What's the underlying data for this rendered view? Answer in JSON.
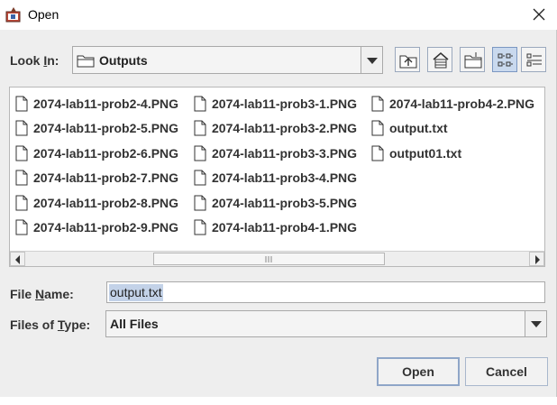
{
  "window": {
    "title": "Open"
  },
  "look_in": {
    "label_pre": "Look ",
    "label_mnemonic": "I",
    "label_post": "n:",
    "value": "Outputs"
  },
  "toolbar": {
    "up_icon": "up-one-level-icon",
    "home_icon": "home-icon",
    "new_folder_icon": "new-folder-icon",
    "list_icon": "list-view-icon",
    "details_icon": "details-view-icon"
  },
  "files": {
    "columns": [
      [
        "2074-lab11-prob2-4.PNG",
        "2074-lab11-prob2-5.PNG",
        "2074-lab11-prob2-6.PNG",
        "2074-lab11-prob2-7.PNG",
        "2074-lab11-prob2-8.PNG",
        "2074-lab11-prob2-9.PNG"
      ],
      [
        "2074-lab11-prob3-1.PNG",
        "2074-lab11-prob3-2.PNG",
        "2074-lab11-prob3-3.PNG",
        "2074-lab11-prob3-4.PNG",
        "2074-lab11-prob3-5.PNG",
        "2074-lab11-prob4-1.PNG"
      ],
      [
        "2074-lab11-prob4-2.PNG",
        "output.txt",
        "output01.txt"
      ]
    ]
  },
  "file_name": {
    "label_pre": "File ",
    "label_mnemonic": "N",
    "label_post": "ame:",
    "value": "output.txt"
  },
  "file_type": {
    "label_pre": "Files of ",
    "label_mnemonic": "T",
    "label_post": "ype:",
    "value": "All Files"
  },
  "buttons": {
    "open": "Open",
    "cancel": "Cancel"
  }
}
